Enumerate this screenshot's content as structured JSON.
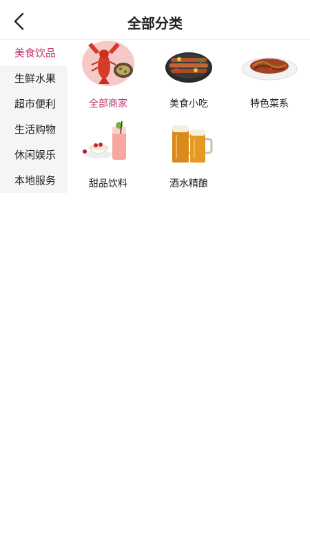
{
  "header": {
    "title": "全部分类",
    "back_icon": "chevron-left-icon"
  },
  "sidebar": {
    "active_color": "#c2336e",
    "items": [
      {
        "label": "美食饮品",
        "active": true
      },
      {
        "label": "生鲜水果",
        "active": false
      },
      {
        "label": "超市便利",
        "active": false
      },
      {
        "label": "生活购物",
        "active": false
      },
      {
        "label": "休闲娱乐",
        "active": false
      },
      {
        "label": "本地服务",
        "active": false
      }
    ]
  },
  "categories": [
    {
      "label": "全部商家",
      "active": true,
      "image": "crayfish-image"
    },
    {
      "label": "美食小吃",
      "active": false,
      "image": "bbq-skewers-image"
    },
    {
      "label": "特色菜系",
      "active": false,
      "image": "noodle-plate-image"
    },
    {
      "label": "甜品饮料",
      "active": false,
      "image": "dessert-drink-image"
    },
    {
      "label": "酒水精酿",
      "active": false,
      "image": "beer-mugs-image"
    }
  ]
}
